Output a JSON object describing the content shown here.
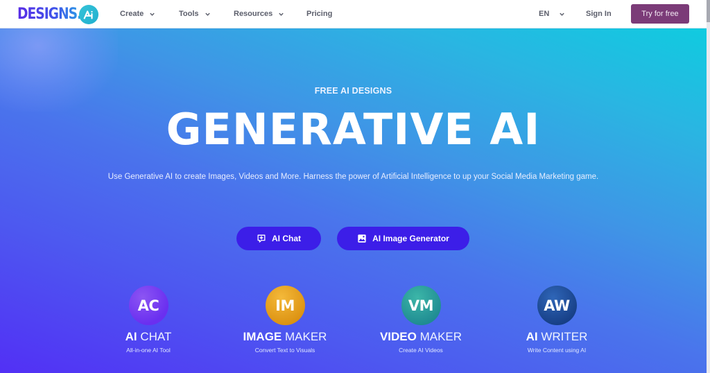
{
  "navbar": {
    "logo_text": "DESIGNS.",
    "logo_badge_icon": "ai-badge-icon",
    "menu": [
      {
        "label": "Create",
        "has_dropdown": true
      },
      {
        "label": "Tools",
        "has_dropdown": true
      },
      {
        "label": "Resources",
        "has_dropdown": true
      },
      {
        "label": "Pricing",
        "has_dropdown": false
      }
    ],
    "language": {
      "label": "EN",
      "has_dropdown": true
    },
    "sign_in_label": "Sign In",
    "try_free_label": "Try for free",
    "try_free_color": "#7b3b78"
  },
  "hero": {
    "eyebrow": "FREE AI DESIGNS",
    "title": "GENERATIVE AI",
    "subtitle": "Use Generative AI to create Images, Videos and More. Harness the power of Artificial Intelligence to up your Social Media Marketing game.",
    "gradient_colors": [
      "#5230f5",
      "#4a74ec",
      "#10cbe0"
    ],
    "buttons": [
      {
        "label": "AI Chat",
        "icon": "chat-plus-icon"
      },
      {
        "label": "AI Image Generator",
        "icon": "image-icon"
      }
    ],
    "button_color": "#3c1ee8"
  },
  "tools": [
    {
      "initials": "AC",
      "name_bold": "AI",
      "name_rest": "CHAT",
      "description": "All-in-one AI Tool",
      "color": "#7a3cf0"
    },
    {
      "initials": "IM",
      "name_bold": "IMAGE",
      "name_rest": "MAKER",
      "description": "Convert Text to Visuals",
      "color": "#e6a21c"
    },
    {
      "initials": "VM",
      "name_bold": "VIDEO",
      "name_rest": "MAKER",
      "description": "Create AI Videos",
      "color": "#2a9e9a"
    },
    {
      "initials": "AW",
      "name_bold": "AI",
      "name_rest": "WRITER",
      "description": "Write Content using AI",
      "color": "#1e4d9c"
    }
  ]
}
